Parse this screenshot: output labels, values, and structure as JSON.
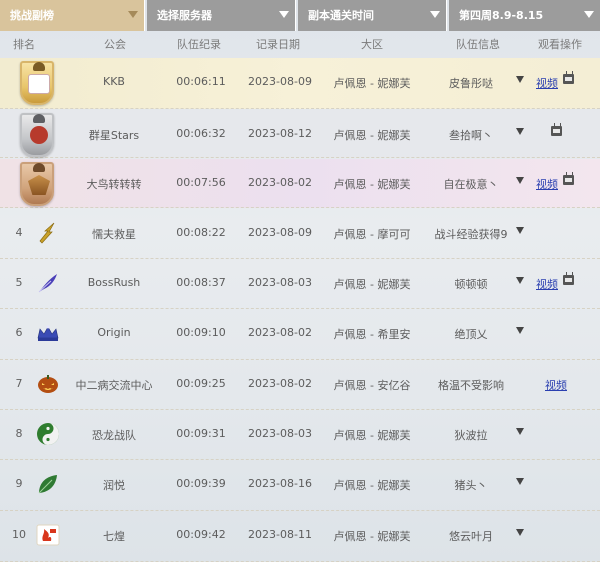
{
  "filters": {
    "challenge": "挑战副榜",
    "server": "选择服务器",
    "dungeon_time": "副本通关时间",
    "week": "第四周8.9-8.15"
  },
  "columns": {
    "rank": "排名",
    "guild": "公会",
    "team_record": "队伍纪录",
    "record_date": "记录日期",
    "region": "大区",
    "team_info": "队伍信息",
    "actions": "观看操作"
  },
  "rows": [
    {
      "rank": "",
      "badge": "gold-medal-icon",
      "guild": "KKB",
      "time": "00:06:11",
      "date": "2023-08-09",
      "region": "卢佩恩 - 妮娜芙",
      "info": "皮鲁彤哒",
      "video": "视频",
      "tv": true
    },
    {
      "rank": "",
      "badge": "silver-medal-icon",
      "guild": "群星Stars",
      "time": "00:06:32",
      "date": "2023-08-12",
      "region": "卢佩恩 - 妮娜芙",
      "info": "叁拾啊丶",
      "video": "",
      "tv": true
    },
    {
      "rank": "",
      "badge": "bronze-medal-icon",
      "guild": "大鸟转转转",
      "time": "00:07:56",
      "date": "2023-08-02",
      "region": "卢佩恩 - 妮娜芙",
      "info": "自在极意丶",
      "video": "视频",
      "tv": true
    },
    {
      "rank": "4",
      "badge": "lightning-logo-icon",
      "guild": "懦夫救星",
      "time": "00:08:22",
      "date": "2023-08-09",
      "region": "卢佩恩 - 摩可可",
      "info": "战斗经验获得9",
      "video": "",
      "tv": false
    },
    {
      "rank": "5",
      "badge": "feather-logo-icon",
      "guild": "BossRush",
      "time": "00:08:37",
      "date": "2023-08-03",
      "region": "卢佩恩 - 妮娜芙",
      "info": "顿顿顿",
      "video": "视频",
      "tv": true
    },
    {
      "rank": "6",
      "badge": "crown-logo-icon",
      "guild": "Origin",
      "time": "00:09:10",
      "date": "2023-08-02",
      "region": "卢佩恩 - 希里安",
      "info": "绝顶乂",
      "video": "",
      "tv": false
    },
    {
      "rank": "7",
      "badge": "pumpkin-logo-icon",
      "guild": "中二病交流中心",
      "time": "00:09:25",
      "date": "2023-08-02",
      "region": "卢佩恩 - 安亿谷",
      "info": "格温不受影响",
      "video": "视频",
      "tv": false
    },
    {
      "rank": "8",
      "badge": "yin-yang-logo-icon",
      "guild": "恐龙战队",
      "time": "00:09:31",
      "date": "2023-08-03",
      "region": "卢佩恩 - 妮娜芙",
      "info": "狄波拉",
      "video": "",
      "tv": false
    },
    {
      "rank": "9",
      "badge": "leaf-logo-icon",
      "guild": "润悦",
      "time": "00:09:39",
      "date": "2023-08-16",
      "region": "卢佩恩 - 妮娜芙",
      "info": "猪头丶",
      "video": "",
      "tv": false
    },
    {
      "rank": "10",
      "badge": "flame-logo-icon",
      "guild": "七煌",
      "time": "00:09:42",
      "date": "2023-08-11",
      "region": "卢佩恩 - 妮娜芙",
      "info": "悠云叶月",
      "video": "",
      "tv": false
    }
  ],
  "colors": {
    "active_filter": "#d9c49c",
    "inactive_filter": "#9c9c9c",
    "link": "#2a3fb0"
  }
}
